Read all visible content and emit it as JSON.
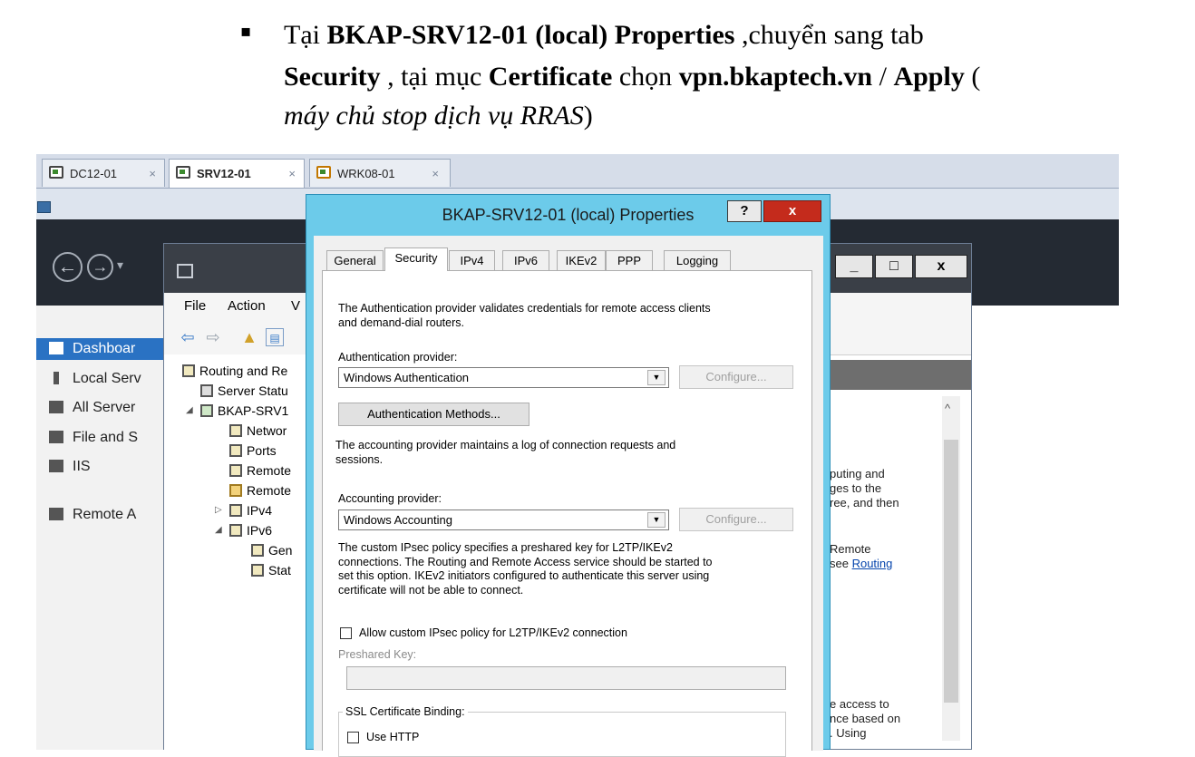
{
  "document": {
    "bullet": "▪",
    "line1": {
      "p1": "Tại ",
      "b1": "BKAP-SRV12-01 (local) Properties",
      "p2": " ,chuyển sang tab"
    },
    "line2": {
      "b1": "Security",
      "p1": " , tại mục ",
      "b2": "Certificate",
      "p2": " chọn ",
      "b3": "vpn.bkaptech.vn",
      "p3": " / ",
      "b4": "Apply",
      "p4": " ("
    },
    "line3": {
      "i1": "máy chủ stop dịch vụ RRAS",
      "p1": ")"
    }
  },
  "vm_tabs": [
    {
      "label": "DC12-01",
      "close": "×"
    },
    {
      "label": "SRV12-01",
      "close": "×"
    },
    {
      "label": "WRK08-01",
      "close": "×"
    }
  ],
  "server_manager": {
    "nav": {
      "back": "←",
      "forward": "→",
      "dropdown": "▾"
    },
    "sidebar": [
      {
        "label": "Dashboar"
      },
      {
        "label": "Local Serv"
      },
      {
        "label": "All Server"
      },
      {
        "label": "File and S"
      },
      {
        "label": "IIS"
      },
      {
        "label": "Remote A"
      }
    ]
  },
  "rras": {
    "window_buttons": {
      "minimize": "_",
      "maximize": "□",
      "close": "x"
    },
    "menu": [
      "File",
      "Action",
      "V"
    ],
    "tree": [
      {
        "label": "Routing and Re"
      },
      {
        "label": "Server Statu"
      },
      {
        "label": "BKAP-SRV1",
        "expander": "◢"
      },
      {
        "label": "Networ"
      },
      {
        "label": "Ports"
      },
      {
        "label": "Remote"
      },
      {
        "label": "Remote"
      },
      {
        "label": "IPv4",
        "expander": "▷"
      },
      {
        "label": "IPv6",
        "expander": "◢"
      },
      {
        "label": "Gen"
      },
      {
        "label": "Stat"
      }
    ],
    "right_pane": {
      "para1": [
        "puting and",
        "ges to the",
        "ree, and then"
      ],
      "para2": [
        "Remote"
      ],
      "para2_see": "see ",
      "para2_link": "Routing",
      "para3": [
        "e access to",
        "nce based on",
        ". Using"
      ],
      "scroll_up": "^"
    }
  },
  "dialog": {
    "title": "BKAP-SRV12-01 (local) Properties",
    "help": "?",
    "close": "x",
    "tabs": [
      "General",
      "Security",
      "IPv4",
      "IPv6",
      "IKEv2",
      "PPP",
      "Logging"
    ],
    "selected_tab": "Security",
    "auth_desc": [
      "The Authentication provider validates credentials for remote access clients",
      "and demand-dial routers."
    ],
    "auth_provider_label": "Authentication provider:",
    "auth_provider_value": "Windows Authentication",
    "configure_label": "Configure...",
    "auth_methods_button": "Authentication Methods...",
    "acct_desc": [
      "The accounting provider maintains a log of connection requests and",
      "sessions."
    ],
    "acct_provider_label": "Accounting provider:",
    "acct_provider_value": "Windows Accounting",
    "ipsec_desc": [
      "The custom IPsec policy specifies a preshared key for L2TP/IKEv2",
      "connections. The Routing and Remote Access service should be started to",
      "set this option. IKEv2 initiators configured to authenticate this server using",
      "certificate will not be able to connect."
    ],
    "allow_ipsec_label": "Allow custom IPsec policy for L2TP/IKEv2 connection",
    "allow_ipsec_checked": false,
    "preshared_key_label": "Preshared Key:",
    "preshared_key_value": "",
    "ssl_group_label": "SSL Certificate Binding:",
    "use_http_label": "Use HTTP",
    "use_http_checked": false,
    "dropdown_glyph": "▼"
  }
}
